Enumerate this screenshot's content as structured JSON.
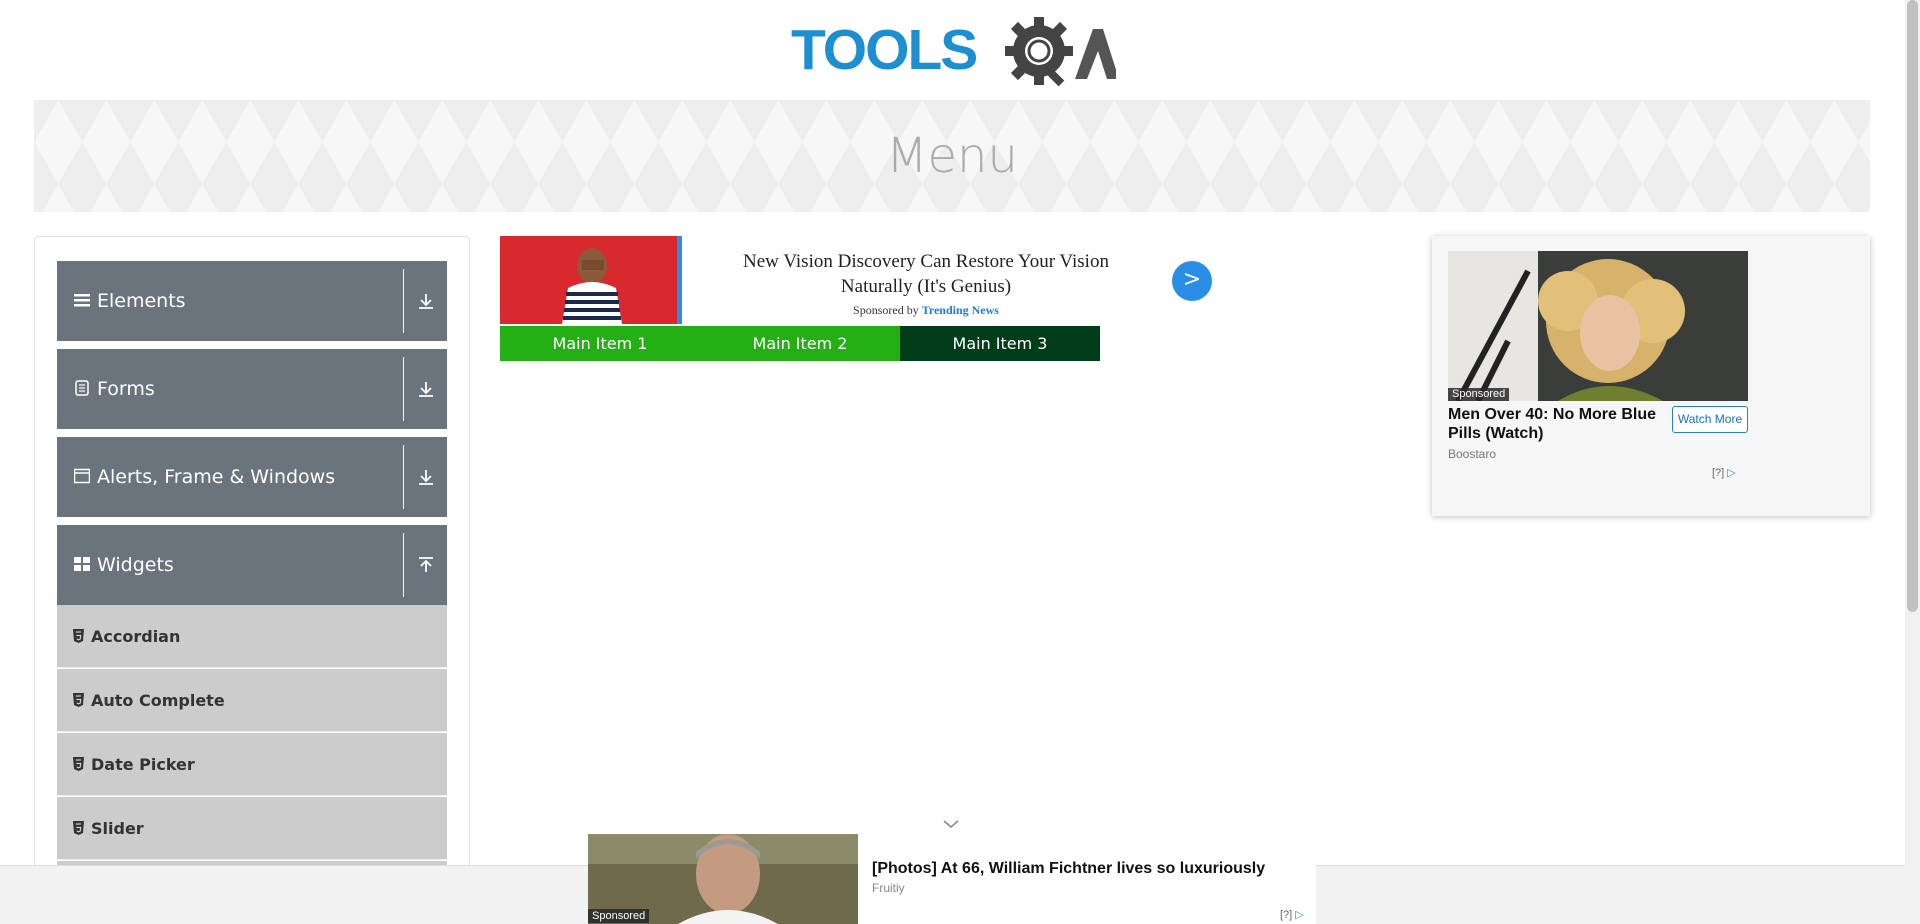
{
  "header": {
    "logo_text_tools": "TOOLS",
    "logo_text_qa": "QA"
  },
  "banner": {
    "title": "Menu"
  },
  "sidebar": {
    "groups": [
      {
        "label": "Elements",
        "icon": "hamburger-icon",
        "state": "collapsed"
      },
      {
        "label": "Forms",
        "icon": "form-icon",
        "state": "collapsed"
      },
      {
        "label": "Alerts, Frame & Windows",
        "icon": "window-icon",
        "state": "collapsed"
      },
      {
        "label": "Widgets",
        "icon": "widgets-icon",
        "state": "expanded"
      }
    ],
    "widget_items": [
      {
        "label": "Accordian"
      },
      {
        "label": "Auto Complete"
      },
      {
        "label": "Date Picker"
      },
      {
        "label": "Slider"
      }
    ]
  },
  "top_ad": {
    "headline": "New Vision Discovery Can Restore Your Vision Naturally (It's Genius)",
    "sponsor_prefix": "Sponsored by",
    "sponsor_name": "Trending News",
    "next_label": ">"
  },
  "nav": {
    "items": [
      {
        "label": "Main Item 1"
      },
      {
        "label": "Main Item 2"
      },
      {
        "label": "Main Item 3"
      }
    ]
  },
  "right_ad": {
    "tag": "Sponsored",
    "title": "Men Over 40: No More Blue Pills (Watch)",
    "brand": "Boostaro",
    "cta": "Watch More",
    "adchoice": "[?]"
  },
  "bottom_ad": {
    "tag": "Sponsored",
    "title": "[Photos] At 66, William Fichtner lives so luxuriously",
    "brand": "Fruitiy",
    "adchoice": "[?]"
  },
  "colors": {
    "brand_blue": "#1d8fd0",
    "sidebar_group": "#6b737c",
    "sidebar_item": "#cccccc",
    "nav_green": "#24af15",
    "nav_dark_green": "#003d19"
  }
}
